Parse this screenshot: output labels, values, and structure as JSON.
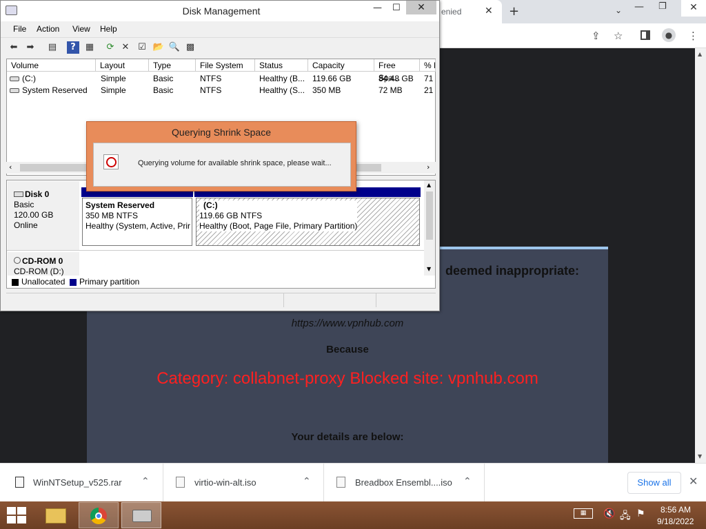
{
  "browser": {
    "tab_title": "enied",
    "tab_close": "✕",
    "new_tab": "+",
    "tab_dropdown": "⌄",
    "win_min": "—",
    "win_max": "❐",
    "win_close": "✕",
    "toolbar_icons": [
      "share-icon",
      "star-icon",
      "side-panel-icon",
      "profile-icon",
      "more-icon"
    ]
  },
  "blocked_page": {
    "headline": "deemed inappropriate:",
    "url": "https://www.vpnhub.com",
    "because": "Because",
    "category": "Category: collabnet-proxy  Blocked site: vpnhub.com",
    "details": "Your details are below:"
  },
  "downloads": {
    "items": [
      {
        "name": "WinNTSetup_v525.rar"
      },
      {
        "name": "virtio-win-alt.iso"
      },
      {
        "name": "Breadbox Ensembl....iso"
      }
    ],
    "chevron": "⌃",
    "show_all": "Show all",
    "close": "✕"
  },
  "taskbar": {
    "time": "8:56 AM",
    "date": "9/18/2022"
  },
  "disk_mgmt": {
    "title": "Disk Management",
    "controls": {
      "min": "—",
      "max": "☐",
      "close": "✕"
    },
    "menu": [
      "File",
      "Action",
      "View",
      "Help"
    ],
    "columns": [
      "Volume",
      "Layout",
      "Type",
      "File System",
      "Status",
      "Capacity",
      "Free Spa...",
      "% F"
    ],
    "volumes": [
      {
        "volume": "(C:)",
        "layout": "Simple",
        "type": "Basic",
        "fs": "NTFS",
        "status": "Healthy (B...",
        "capacity": "119.66 GB",
        "free": "84.48 GB",
        "pct": "71"
      },
      {
        "volume": "System Reserved",
        "layout": "Simple",
        "type": "Basic",
        "fs": "NTFS",
        "status": "Healthy (S...",
        "capacity": "350 MB",
        "free": "72 MB",
        "pct": "21"
      }
    ],
    "disks": [
      {
        "name": "Disk 0",
        "type": "Basic",
        "size": "120.00 GB",
        "state": "Online"
      },
      {
        "name": "CD-ROM 0",
        "type": "CD-ROM (D:)"
      }
    ],
    "partitions": [
      {
        "name": "System Reserved",
        "size": "350 MB NTFS",
        "status": "Healthy (System, Active, Prir"
      },
      {
        "name": "(C:)",
        "size": "119.66 GB NTFS",
        "status": "Healthy (Boot, Page File, Primary Partition)"
      }
    ],
    "legend": [
      {
        "label": "Unallocated",
        "color": "#000000"
      },
      {
        "label": "Primary partition",
        "color": "#00008b"
      }
    ]
  },
  "dialog": {
    "title": "Querying Shrink Space",
    "message": "Querying volume for available shrink space, please wait..."
  },
  "colors": {
    "dialog_frame": "#e88c5a",
    "blocked_category": "#ff2020",
    "primary_partition": "#00008b",
    "taskbar": "#7a4a2a"
  }
}
